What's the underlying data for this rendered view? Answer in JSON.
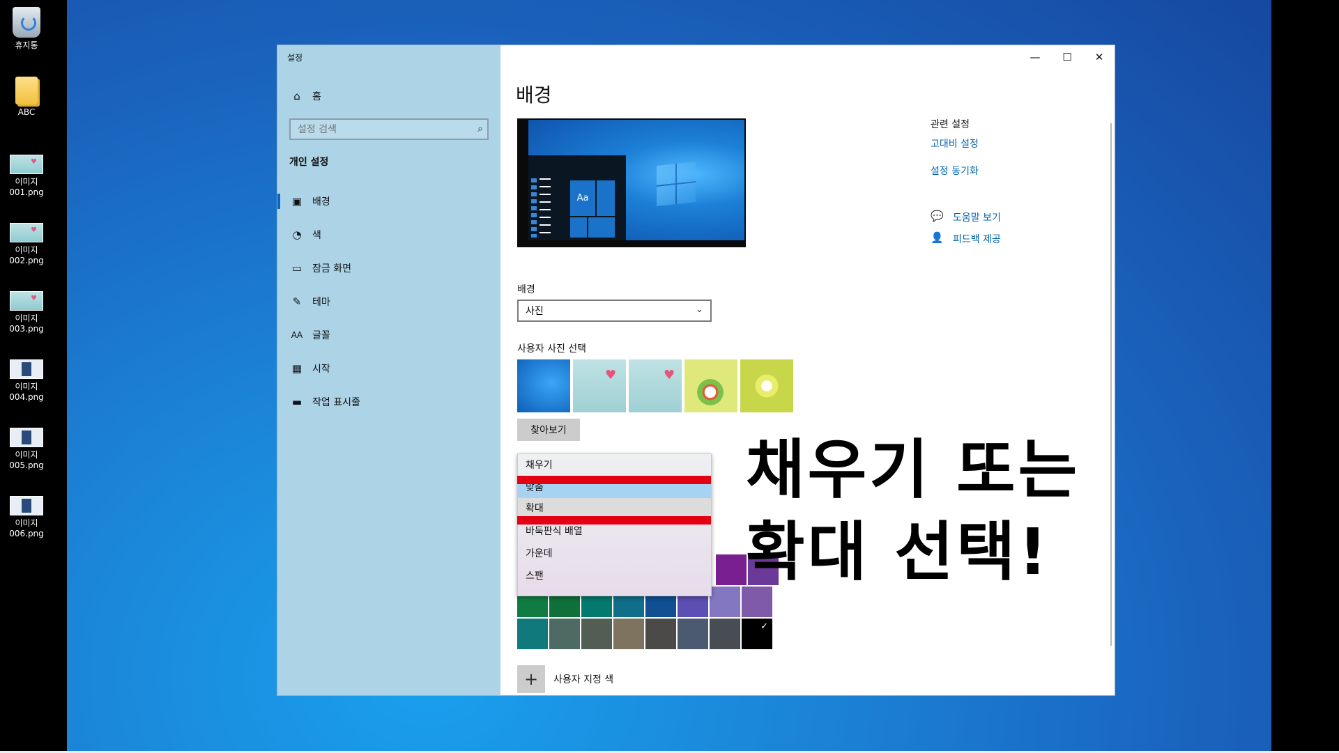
{
  "desktop_icons": [
    {
      "label": "휴지통",
      "kind": "recycle"
    },
    {
      "label": "ABC",
      "kind": "folder"
    },
    {
      "label": "이미지\n001.png",
      "kind": "image"
    },
    {
      "label": "이미지\n002.png",
      "kind": "image"
    },
    {
      "label": "이미지\n003.png",
      "kind": "image"
    },
    {
      "label": "이미지\n004.png",
      "kind": "image"
    },
    {
      "label": "이미지\n005.png",
      "kind": "image"
    },
    {
      "label": "이미지\n006.png",
      "kind": "image"
    }
  ],
  "window": {
    "title": "설정",
    "controls": {
      "minimize": "—",
      "maximize": "☐",
      "close": "✕"
    }
  },
  "sidebar": {
    "home": "홈",
    "search_placeholder": "설정 검색",
    "section": "개인 설정",
    "items": [
      {
        "label": "배경",
        "icon": "image-icon",
        "selected": true
      },
      {
        "label": "색",
        "icon": "palette-icon"
      },
      {
        "label": "잠금 화면",
        "icon": "lock-screen-icon"
      },
      {
        "label": "테마",
        "icon": "theme-icon"
      },
      {
        "label": "글꼴",
        "icon": "font-icon"
      },
      {
        "label": "시작",
        "icon": "start-icon"
      },
      {
        "label": "작업 표시줄",
        "icon": "taskbar-icon"
      }
    ]
  },
  "main": {
    "title": "배경",
    "preview_tile_text": "Aa",
    "background_label": "배경",
    "background_value": "사진",
    "photos_label": "사용자 사진 선택",
    "browse_label": "찾아보기",
    "fit_menu": [
      "채우기",
      "맞춤",
      "확대",
      "바둑판식 배열",
      "가운데",
      "스팬"
    ],
    "custom_color_label": "사용자 지정 색",
    "swatches_row0": [
      "#7a1f8f",
      "#6b3a99"
    ],
    "swatches_row1": [
      "#107c41",
      "#10703a",
      "#037a6d",
      "#0f6e8a",
      "#0f4f92",
      "#5c4fb3",
      "#8377c2",
      "#7e5aa8"
    ],
    "swatches_row2": [
      "#10797c",
      "#4d6b62",
      "#525e54",
      "#7e735f",
      "#4c4a48",
      "#4b5a70",
      "#474d52",
      "#000000"
    ]
  },
  "related": {
    "heading": "관련 설정",
    "high_contrast": "고대비 설정",
    "sync": "설정 동기화",
    "help": "도움말 보기",
    "feedback": "피드백 제공"
  },
  "overlay": {
    "line1": "채우기 또는",
    "line2": "확대 선택!"
  }
}
